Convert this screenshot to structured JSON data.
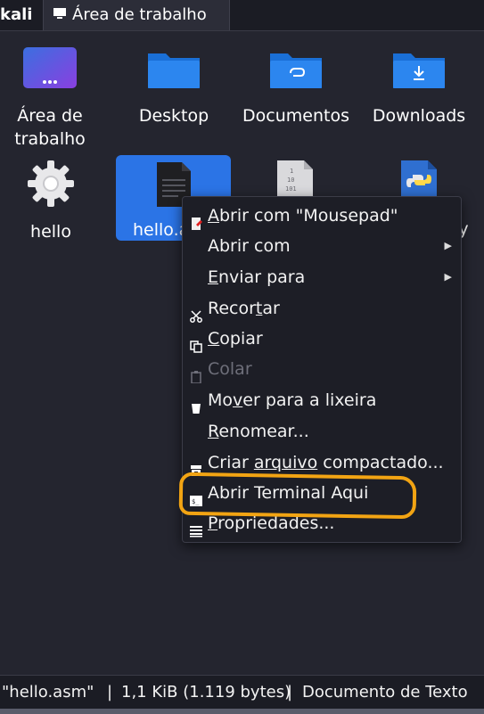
{
  "tabs": {
    "active_label": "kali",
    "path_label": "Área de trabalho"
  },
  "desktop_items": [
    {
      "label_line1": "Área de",
      "label_line2": "trabalho",
      "icon": "desktop-folder-icon"
    },
    {
      "label_line1": "Desktop",
      "icon": "folder-icon"
    },
    {
      "label_line1": "Documentos",
      "icon": "documents-folder-icon"
    },
    {
      "label_line1": "Downloads",
      "icon": "downloads-folder-icon"
    },
    {
      "label_line1": "hello",
      "icon": "gear-executable-icon"
    },
    {
      "label_line1": "hello.a",
      "icon": "text-document-icon"
    },
    {
      "label_line1": "",
      "icon": "binary-file-icon"
    },
    {
      "label_line1": "y",
      "icon": "python-file-icon"
    }
  ],
  "context_menu": {
    "items": [
      {
        "pre": "",
        "u": "A",
        "post": "brir com \"Mousepad\"",
        "icon": "mousepad-icon"
      },
      {
        "pre": "Abrir com",
        "u": "",
        "post": "",
        "icon": ""
      },
      {
        "pre": "",
        "u": "E",
        "post": "nviar para",
        "icon": ""
      },
      {
        "pre": "Recor",
        "u": "t",
        "post": "ar",
        "icon": "scissors-icon"
      },
      {
        "pre": "",
        "u": "C",
        "post": "opiar",
        "icon": "copy-icon"
      },
      {
        "pre": "Colar",
        "u": "",
        "post": "",
        "icon": "paste-icon"
      },
      {
        "pre": "Mo",
        "u": "v",
        "post": "er para a lixeira",
        "icon": "trash-icon"
      },
      {
        "pre": "",
        "u": "R",
        "post": "enomear...",
        "icon": ""
      },
      {
        "pre": "Criar ",
        "u": "arquivo",
        "post": " compactado...",
        "icon": "archive-icon"
      },
      {
        "pre": "Abrir Terminal Aqui",
        "u": "",
        "post": "",
        "icon": "terminal-icon"
      },
      {
        "pre": "",
        "u": "P",
        "post": "ropriedades...",
        "icon": "properties-icon"
      }
    ],
    "submenu_arrow": "▶"
  },
  "statusbar": {
    "filename": "\"hello.asm\"",
    "sep1": "|",
    "size": "1,1 KiB (1.119 bytes)",
    "sep2": "|",
    "type": "Documento de Texto"
  },
  "colors": {
    "background": "#24252f",
    "selection": "#2b74e6",
    "folder_blue": "#1f7ae0",
    "highlight_annotation": "#f2a413"
  }
}
